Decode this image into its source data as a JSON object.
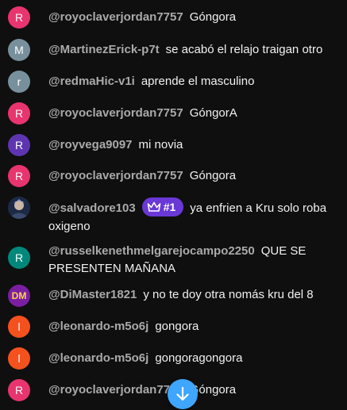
{
  "colors": {
    "background": "#0f0f0f",
    "author": "#aaaaaa",
    "message": "#f1f1f1",
    "badge": "#6a38d6",
    "scroll_button": "#3ea6ff"
  },
  "messages": [
    {
      "avatar_letter": "R",
      "avatar_color": "#e8346f",
      "author": "@royoclaverjordan7757",
      "text": "Góngora"
    },
    {
      "avatar_letter": "M",
      "avatar_color": "#78909c",
      "author": "@MartinezErick-p7t",
      "text": "se acabó el relajo traigan otro"
    },
    {
      "avatar_letter": "r",
      "avatar_color": "#78909c",
      "author": "@redmaHic-v1i",
      "text": "aprende el masculino"
    },
    {
      "avatar_letter": "R",
      "avatar_color": "#e8346f",
      "author": "@royoclaverjordan7757",
      "text": "GóngorA"
    },
    {
      "avatar_letter": "R",
      "avatar_color": "#5e35b1",
      "author": "@royvega9097",
      "text": "mi novia"
    },
    {
      "avatar_letter": "R",
      "avatar_color": "#e8346f",
      "author": "@royoclaverjordan7757",
      "text": "Góngora"
    },
    {
      "avatar_letter": "",
      "avatar_color": "#2a3a55",
      "author": "@salvadore103",
      "badge": "#1",
      "badge_icon": "crown-icon",
      "text": "ya enfrien a Kru solo roba oxigeno"
    },
    {
      "avatar_letter": "R",
      "avatar_color": "#00897b",
      "author": "@russelkenethmelgarejocampo2250",
      "text": "QUE SE PRESENTEN MAÑANA"
    },
    {
      "avatar_letter": "DM",
      "avatar_color": "#7b1fa2",
      "author": "@DiMaster1821",
      "text": "y no te doy otra nomás kru del 8"
    },
    {
      "avatar_letter": "l",
      "avatar_color": "#f4511e",
      "author": "@leonardo-m5o6j",
      "text": "gongora"
    },
    {
      "avatar_letter": "l",
      "avatar_color": "#f4511e",
      "author": "@leonardo-m5o6j",
      "text": "gongoragongora"
    },
    {
      "avatar_letter": "R",
      "avatar_color": "#e8346f",
      "author": "@royoclaverjordan7757",
      "text": "Góngora"
    }
  ],
  "scroll_button_icon": "arrow-down-icon"
}
